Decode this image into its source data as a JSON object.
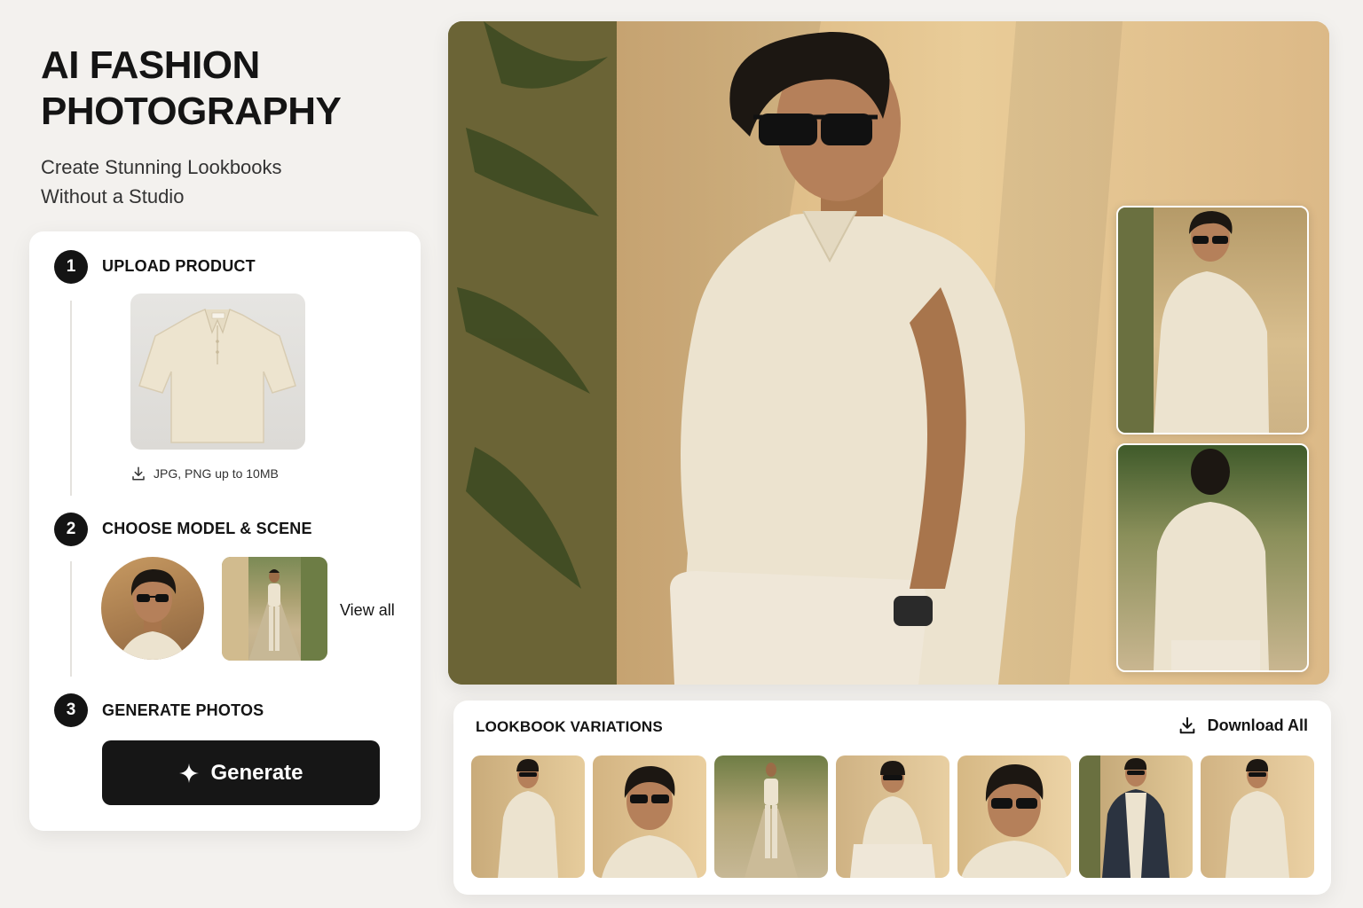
{
  "hero": {
    "title_line1": "AI FASHION",
    "title_line2": "PHOTOGRAPHY",
    "subtitle_line1": "Create Stunning Lookbooks",
    "subtitle_line2": "Without a Studio"
  },
  "steps": {
    "upload": {
      "number": "1",
      "title": "UPLOAD PRODUCT",
      "hint": "JPG, PNG up to 10MB",
      "hint_icon": "download-icon"
    },
    "model": {
      "number": "2",
      "title": "CHOOSE MODEL & SCENE",
      "view_all_label": "View all"
    },
    "generate": {
      "number": "3",
      "title": "GENERATE PHOTOS",
      "button_label": "Generate",
      "button_icon": "sparkle-icon"
    }
  },
  "lookbook": {
    "title": "LOOKBOOK VARIATIONS",
    "download_label": "Download All",
    "download_icon": "download-icon",
    "thumbnail_count": 7
  },
  "colors": {
    "background": "#f3f1ee",
    "accent_dark": "#161616",
    "card": "#ffffff",
    "garment": "#ece3cf"
  }
}
